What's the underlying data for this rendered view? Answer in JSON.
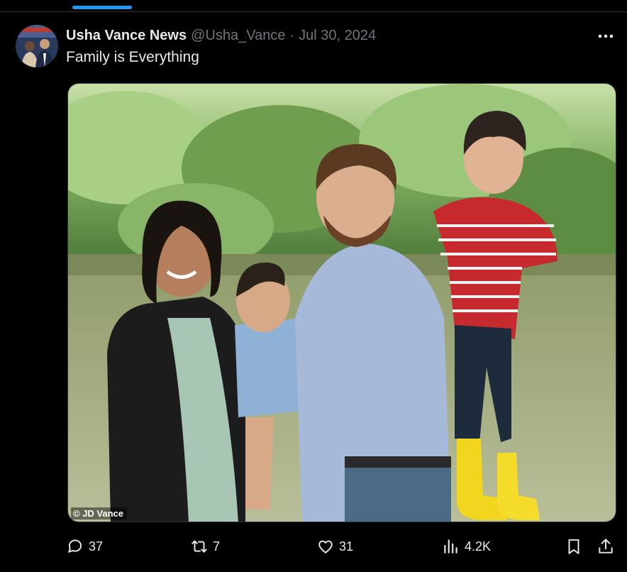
{
  "tweet": {
    "display_name": "Usha Vance News",
    "handle": "@Usha_Vance",
    "separator": "·",
    "date": "Jul 30, 2024",
    "text": "Family is Everything",
    "media": {
      "watermark": "© JD Vance"
    }
  },
  "actions": {
    "reply_count": "37",
    "retweet_count": "7",
    "like_count": "31",
    "view_count": "4.2K"
  },
  "icons": {
    "more": "more-horizontal-icon",
    "reply": "reply-icon",
    "retweet": "retweet-icon",
    "like": "heart-icon",
    "views": "views-icon",
    "bookmark": "bookmark-icon",
    "share": "share-icon"
  },
  "colors": {
    "background": "#000000",
    "text": "#e7e9ea",
    "muted": "#71767b",
    "accent": "#1d9bf0",
    "border": "#2f3336"
  }
}
